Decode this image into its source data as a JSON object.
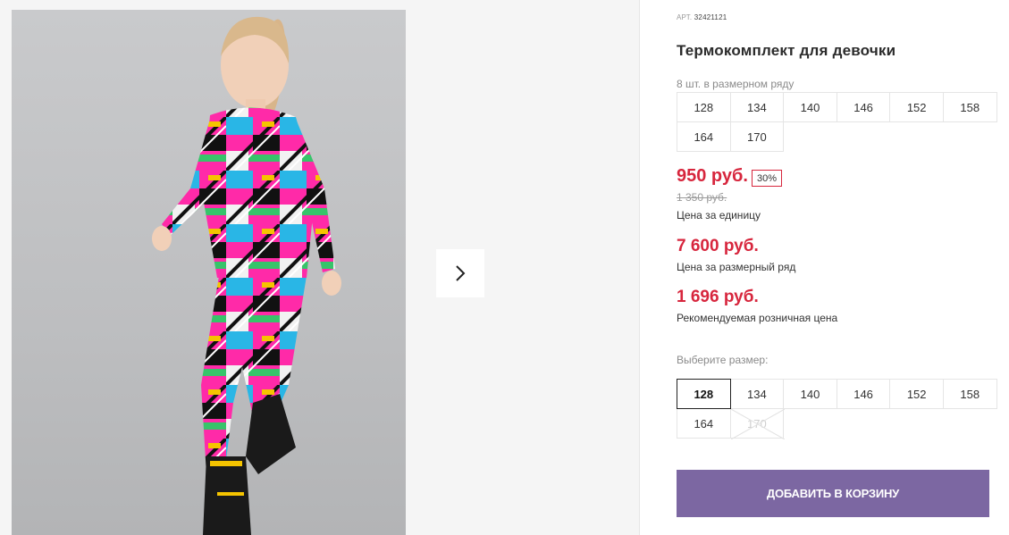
{
  "product": {
    "art_label": "АРТ.",
    "art_number": "32421121",
    "title": "Термокомплект для девочки"
  },
  "size_row": {
    "label": "8 шт. в размерном ряду",
    "sizes": [
      "128",
      "134",
      "140",
      "146",
      "152",
      "158",
      "164",
      "170"
    ]
  },
  "pricing": {
    "unit_price": "950 руб.",
    "discount": "30%",
    "old_price": "1 350 руб.",
    "unit_caption": "Цена за единицу",
    "row_price": "7 600 руб.",
    "row_caption": "Цена за размерный ряд",
    "retail_price": "1 696 руб.",
    "retail_caption": "Рекомендуемая розничная цена"
  },
  "size_select": {
    "label": "Выберите размер:",
    "sizes": [
      "128",
      "134",
      "140",
      "146",
      "152",
      "158",
      "164",
      "170"
    ],
    "selected": "128",
    "unavailable": [
      "170"
    ]
  },
  "cart": {
    "button_label": "ДОБАВИТЬ В КОРЗИНУ"
  },
  "colors": {
    "accent_red": "#d7263d",
    "button_purple": "#7c67a2"
  },
  "icons": {
    "gallery_next": "chevron-right-icon"
  }
}
